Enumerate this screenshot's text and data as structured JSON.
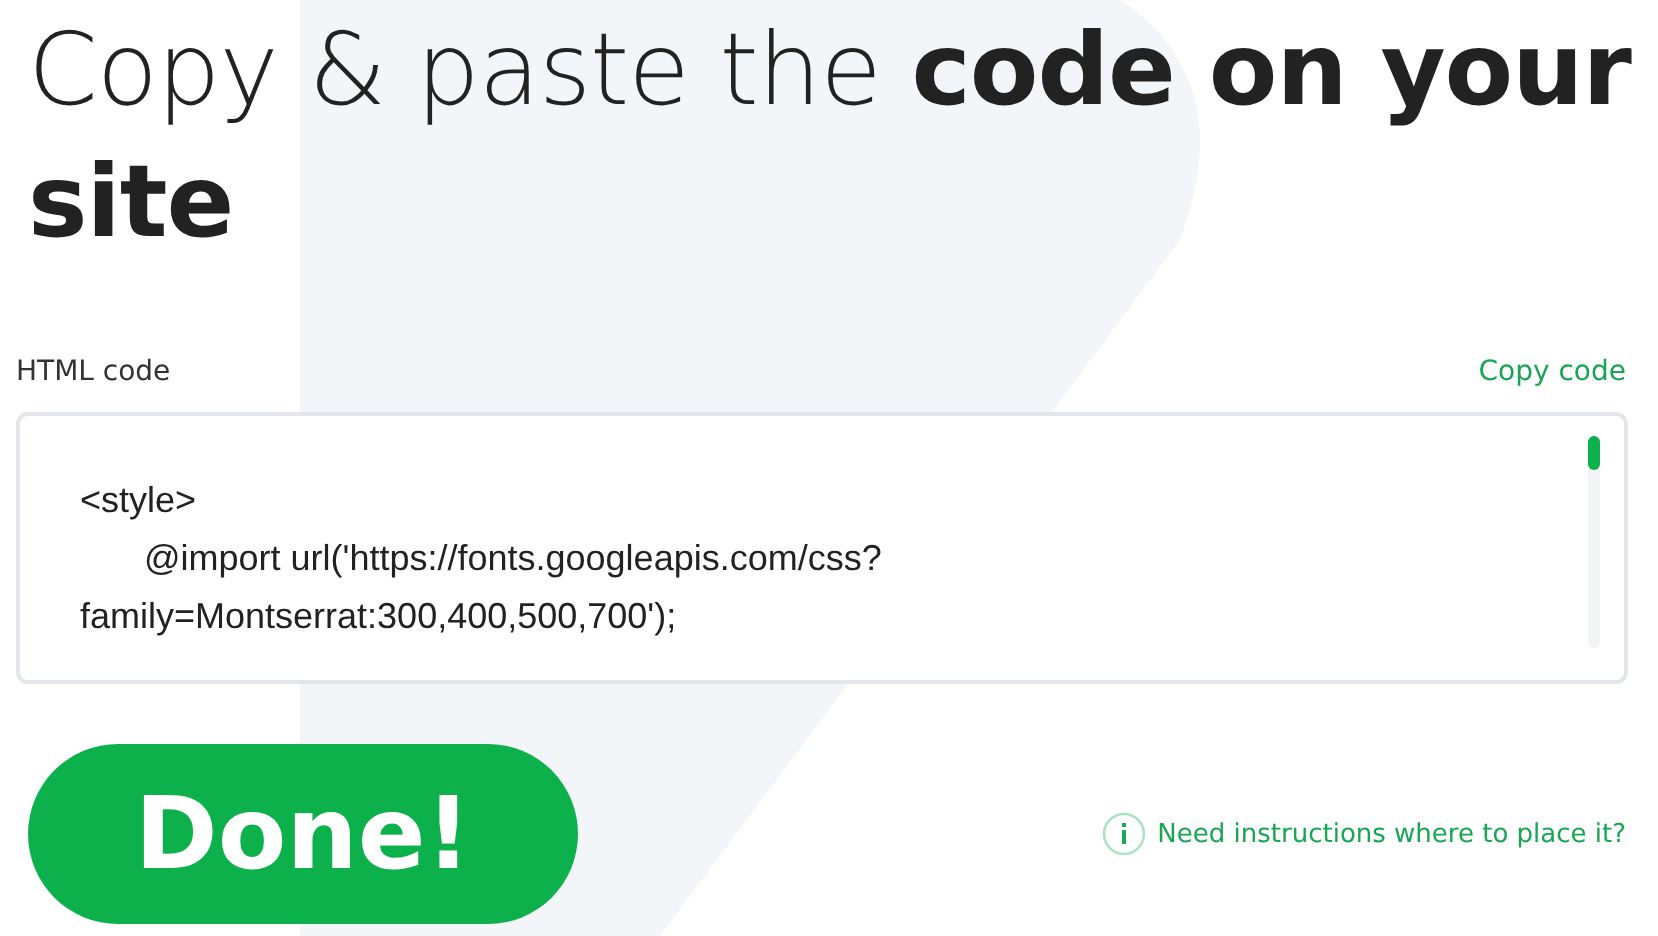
{
  "title": "Copy & paste the **code on your site**",
  "code_field": {
    "label": "HTML code",
    "copy_link": "Copy code",
    "lines": [
      {
        "text": "<style>",
        "indent": false
      },
      {
        "text": "@import url('https://fonts.googleapis.com/css?",
        "indent": true
      },
      {
        "text": "family=Montserrat:300,400,500,700');",
        "indent": false
      }
    ]
  },
  "done_button": "Done!",
  "help_link": "Need instructions where to place it?"
}
